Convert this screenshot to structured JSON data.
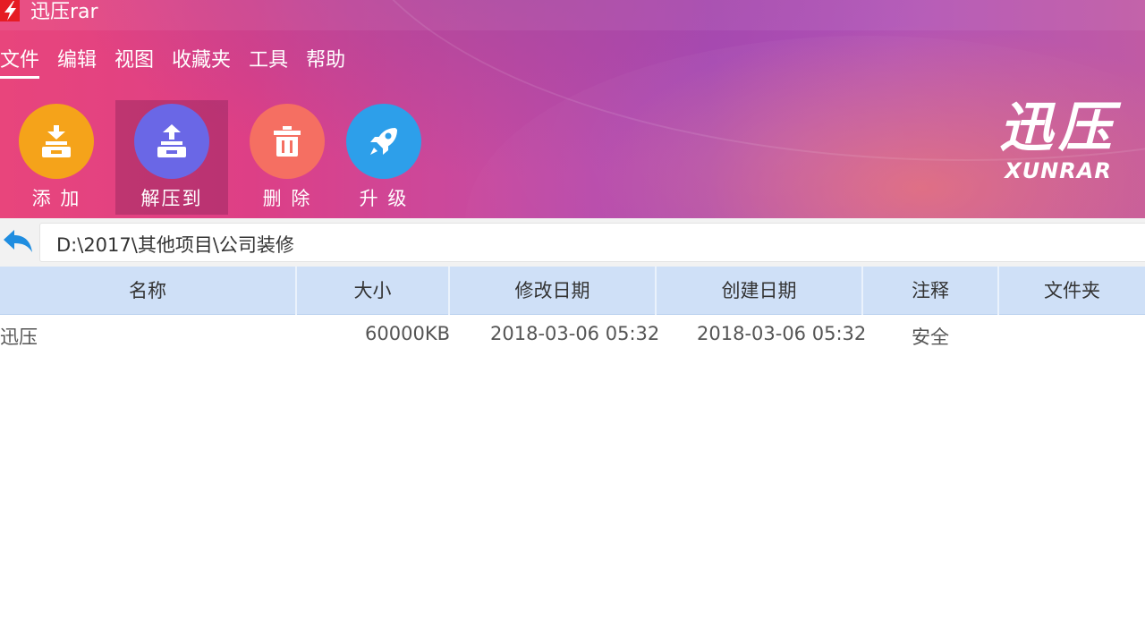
{
  "window": {
    "title": "迅压rar"
  },
  "menu": {
    "items": [
      "文件",
      "编辑",
      "视图",
      "收藏夹",
      "工具",
      "帮助"
    ]
  },
  "toolbar": {
    "add": {
      "label": "添 加",
      "color": "#f5a31a",
      "icon": "add-archive-icon"
    },
    "extract": {
      "label": "解压到",
      "color": "#6a67e6",
      "icon": "extract-icon"
    },
    "delete": {
      "label": "删 除",
      "color": "#f56f62",
      "icon": "trash-icon"
    },
    "upgrade": {
      "label": "升 级",
      "color": "#2d9fea",
      "icon": "rocket-icon"
    }
  },
  "brand": {
    "cn": "迅压",
    "en": "XUNRAR"
  },
  "address": {
    "path": "D:\\2017\\其他项目\\公司装修",
    "back_icon": "back-arrow-icon"
  },
  "table": {
    "columns": [
      "名称",
      "大小",
      "修改日期",
      "创建日期",
      "注释",
      "文件夹"
    ],
    "rows": [
      {
        "name": "迅压",
        "size": "60000KB",
        "modified": "2018-03-06 05:32",
        "created": "2018-03-06 05:32",
        "comment": "安全",
        "folder": ""
      }
    ]
  },
  "colors": {
    "accent_pink": "#e8457c",
    "accent_purple": "#a84ab6",
    "header_blue": "#cfe0f7"
  }
}
